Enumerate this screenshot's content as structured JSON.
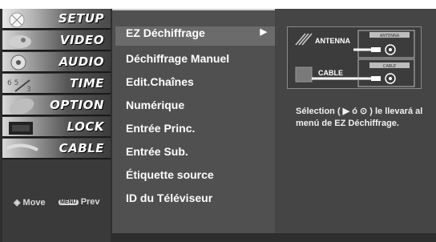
{
  "tabs": [
    {
      "label": "SETUP",
      "active": true
    },
    {
      "label": "VIDEO",
      "active": false
    },
    {
      "label": "AUDIO",
      "active": false
    },
    {
      "label": "TIME",
      "active": false
    },
    {
      "label": "OPTION",
      "active": false
    },
    {
      "label": "LOCK",
      "active": false
    },
    {
      "label": "CABLE",
      "active": false
    }
  ],
  "nav": {
    "move_label": "Move",
    "menu_badge": "MENU",
    "prev_label": "Prev"
  },
  "menu": {
    "items": [
      {
        "label": "EZ Déchiffrage",
        "selected": true,
        "arrow": "▶"
      },
      {
        "label": "Déchiffrage Manuel"
      },
      {
        "label": "Edit.Chaînes"
      },
      {
        "label": "Numérique"
      },
      {
        "label": "Entrée Princ."
      },
      {
        "label": "Entrée Sub."
      },
      {
        "label": "Étiquette source"
      },
      {
        "label": "ID du Téléviseur"
      }
    ]
  },
  "diagram": {
    "antenna_label": "ANTENNA",
    "antenna_port": "ANTENNA",
    "cable_label": "CABLE",
    "cable_port": "CABLE"
  },
  "help_text": "Sélection ( ▶ ó ⊙ ) le llevará al menú de EZ Déchiffrage."
}
